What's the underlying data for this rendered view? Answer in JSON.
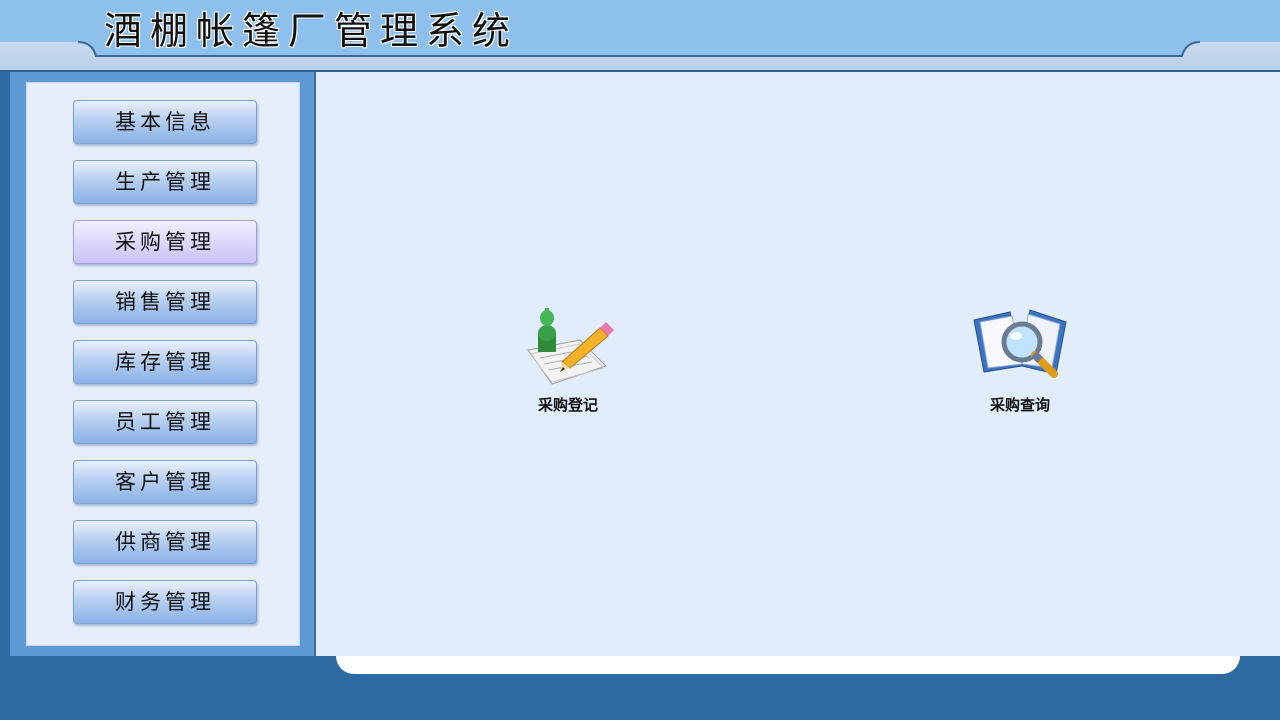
{
  "header": {
    "title": "酒棚帐篷厂管理系统"
  },
  "sidebar": {
    "items": [
      {
        "label": "基本信息",
        "active": false
      },
      {
        "label": "生产管理",
        "active": false
      },
      {
        "label": "采购管理",
        "active": true
      },
      {
        "label": "销售管理",
        "active": false
      },
      {
        "label": "库存管理",
        "active": false
      },
      {
        "label": "员工管理",
        "active": false
      },
      {
        "label": "客户管理",
        "active": false
      },
      {
        "label": "供商管理",
        "active": false
      },
      {
        "label": "财务管理",
        "active": false
      }
    ]
  },
  "main": {
    "functions": [
      {
        "label": "采购登记",
        "icon": "register-pencil-icon"
      },
      {
        "label": "采购查询",
        "icon": "book-magnifier-icon"
      }
    ]
  },
  "colors": {
    "header_band": "#8ec0ee",
    "sidebar_frame": "#5e9ad6",
    "content_bg": "#e2edfc",
    "frame_bg": "#2d6aa0",
    "active_button": "#ddd8fb"
  }
}
